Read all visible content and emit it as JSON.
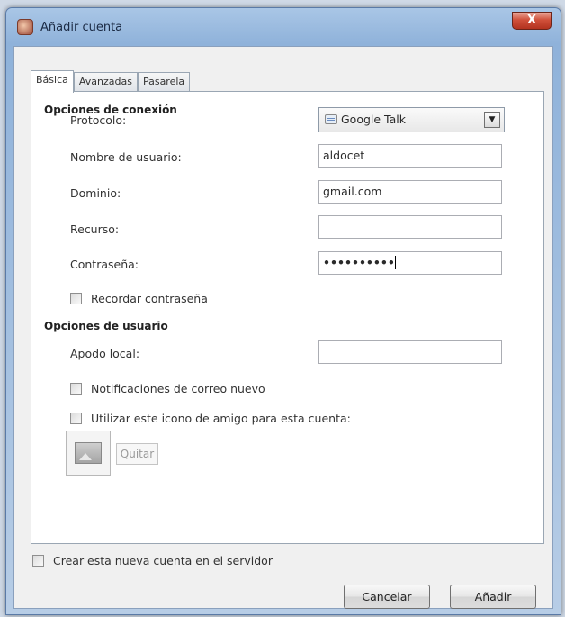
{
  "window": {
    "title": "Añadir cuenta",
    "close_label": "X"
  },
  "tabs": [
    {
      "label": "Básica",
      "active": true
    },
    {
      "label": "Avanzadas",
      "active": false
    },
    {
      "label": "Pasarela",
      "active": false
    }
  ],
  "connection": {
    "section_title": "Opciones de conexión",
    "protocol_label": "Protocolo:",
    "protocol_value": "Google Talk",
    "username_label": "Nombre de usuario:",
    "username_value": "aldocet",
    "domain_label": "Dominio:",
    "domain_value": "gmail.com",
    "resource_label": "Recurso:",
    "resource_value": "",
    "password_label": "Contraseña:",
    "password_value": "••••••••••",
    "remember_password_label": "Recordar contraseña",
    "remember_password_checked": false
  },
  "user_options": {
    "section_title": "Opciones de usuario",
    "local_alias_label": "Apodo local:",
    "local_alias_value": "",
    "new_mail_notifications_label": "Notificaciones de correo nuevo",
    "new_mail_notifications_checked": false,
    "use_buddy_icon_label": "Utilizar este icono de amigo para esta cuenta:",
    "use_buddy_icon_checked": false,
    "remove_button_label": "Quitar"
  },
  "footer": {
    "create_on_server_label": "Crear esta nueva cuenta en el servidor",
    "create_on_server_checked": false,
    "cancel_label": "Cancelar",
    "add_label": "Añadir"
  },
  "colors": {
    "title_bar": "#8fb2da",
    "close_button": "#d0503a",
    "dialog_background": "#f0f0f0",
    "panel_background": "#ffffff"
  }
}
